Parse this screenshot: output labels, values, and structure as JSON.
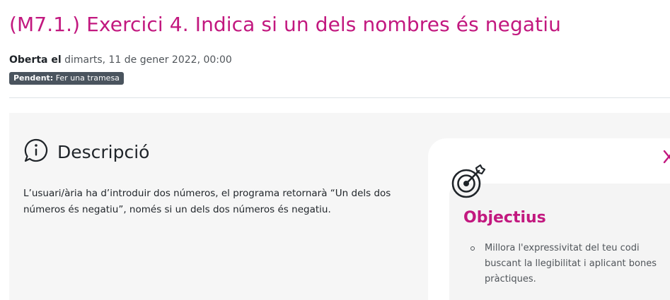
{
  "header": {
    "title": "(M7.1.) Exercici 4. Indica si un dels nombres és negatiu"
  },
  "dates": {
    "opened_label": "Oberta el",
    "opened_value": "dimarts, 11 de gener 2022, 00:00"
  },
  "status": {
    "label": "Pendent:",
    "value": "Fer una tramesa"
  },
  "description": {
    "icon": "info-speech-icon",
    "heading": "Descripció",
    "text": "L’usuari/ària ha d’introduir dos números, el programa retornarà “Un dels dos números és negatiu”, només si un dels dos números és negatiu."
  },
  "objectives": {
    "icon": "target-icon",
    "close_icon": "close-icon",
    "heading": "Objectius",
    "items": [
      "Millora l'expressivitat del teu codi buscant la llegibilitat i aplicant bones pràctiques."
    ]
  },
  "colors": {
    "accent": "#c2187f",
    "badge_bg": "#4a545e",
    "panel_bg": "#f6f6f6"
  }
}
